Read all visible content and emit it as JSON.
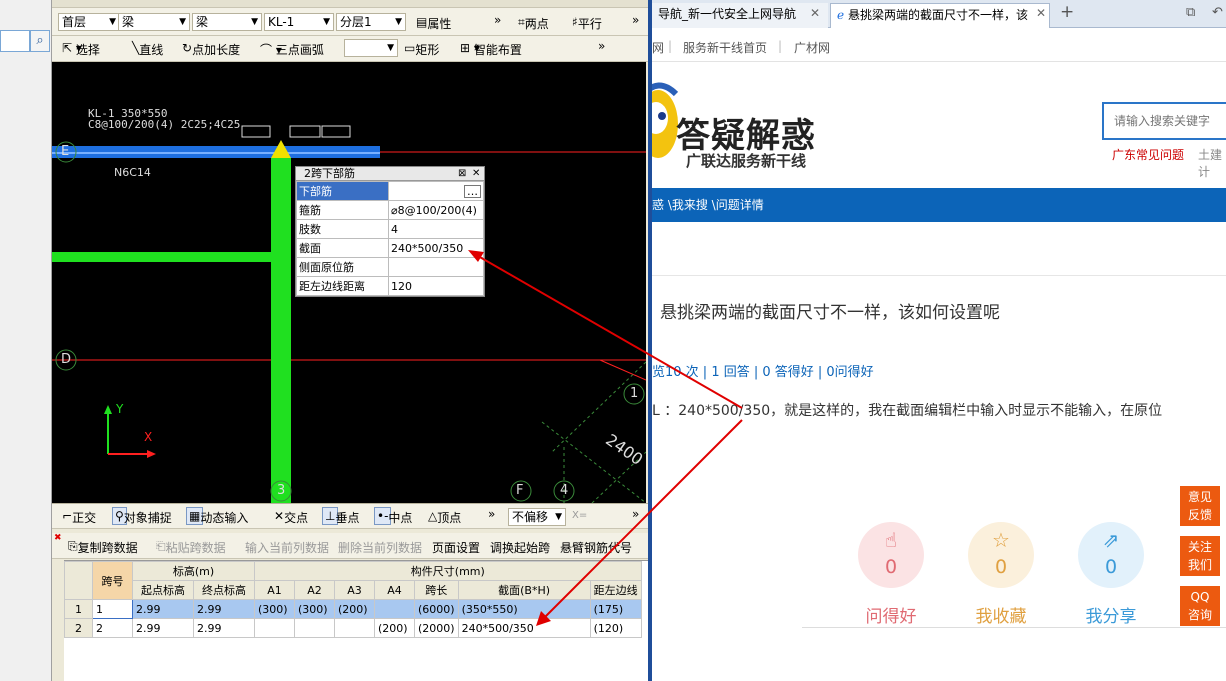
{
  "left_panel": {
    "search_icon": "search-icon"
  },
  "cad": {
    "toolbar1": {
      "floor": "首层",
      "type1": "梁",
      "type2": "梁",
      "component": "KL-1",
      "layer": "分层1",
      "properties": "属性",
      "more": "»",
      "two_points": "两点",
      "parallel": "平行"
    },
    "toolbar2": {
      "select": "选择",
      "line": "直线",
      "point_length": "点加长度",
      "arc": "三点画弧",
      "rect": "矩形",
      "smart": "智能布置",
      "more": "»"
    },
    "canvas": {
      "beam_label_1": "KL-1 350*550",
      "beam_label_2": "C8@100/200(4) 2C25;4C25",
      "rebar_label": "N6C14",
      "axis_e": "E",
      "axis_d": "D",
      "axis_3": "3",
      "axis_f": "F",
      "axis_4": "4",
      "axis_1": "1",
      "dim_2400": "2400",
      "ucs_y": "Y",
      "ucs_x": "X"
    },
    "popup": {
      "title": "2跨下部筋",
      "rows": [
        {
          "key": "下部筋",
          "value": ""
        },
        {
          "key": "箍筋",
          "value": "⌀8@100/200(4)"
        },
        {
          "key": "肢数",
          "value": "4"
        },
        {
          "key": "截面",
          "value": "240*500/350"
        },
        {
          "key": "侧面原位筋",
          "value": ""
        },
        {
          "key": "距左边线距离",
          "value": "120"
        }
      ],
      "ellipsis": "…"
    },
    "snapbar": {
      "ortho": "正交",
      "snap": "对象捕捉",
      "dynamic": "动态输入",
      "intersection": "交点",
      "perpendicular": "垂点",
      "midpoint": "中点",
      "vertex": "顶点",
      "more": "»",
      "offset": "不偏移",
      "x_label": "X="
    },
    "grid_toolbar": {
      "copy_span": "复制跨数据",
      "paste_span": "粘贴跨数据",
      "input_col": "输入当前列数据",
      "delete_col": "删除当前列数据",
      "page_setup": "页面设置",
      "adjust_start": "调换起始跨",
      "cantilever": "悬臂钢筋代号"
    },
    "grid": {
      "header_span_no": "跨号",
      "header_elev": "标高(m)",
      "header_dims": "构件尺寸(mm)",
      "subheaders": [
        "起点标高",
        "终点标高",
        "A1",
        "A2",
        "A3",
        "A4",
        "跨长",
        "截面(B*H)",
        "距左边线"
      ],
      "rows": [
        {
          "rn": "1",
          "span": "1",
          "start": "2.99",
          "end": "2.99",
          "a1": "(300)",
          "a2": "(300)",
          "a3": "(200)",
          "a4": "",
          "len": "(6000)",
          "section": "(350*550)",
          "left": "(175)"
        },
        {
          "rn": "2",
          "span": "2",
          "start": "2.99",
          "end": "2.99",
          "a1": "",
          "a2": "",
          "a3": "",
          "a4": "(200)",
          "len": "(2000)",
          "section": "240*500/350",
          "left": "(120)"
        }
      ]
    }
  },
  "browser": {
    "tabs": [
      {
        "label": "导航_新一代安全上网导航"
      },
      {
        "label": "悬挑梁两端的截面尺寸不一样，该"
      }
    ],
    "new_tab": "+",
    "links": {
      "l0": "网",
      "l1": "服务新干线首页",
      "l2": "广材网",
      "sep": "|"
    },
    "banner": {
      "title": "答疑解惑",
      "subtitle": "广联达服务新干线",
      "search_placeholder": "请输入搜索关键字",
      "hot1": "广东常见问题",
      "hot2": "土建计"
    },
    "breadcrumb": "惑 \\我来搜 \\问题详情",
    "question": {
      "title": "悬挑梁两端的截面尺寸不一样，该如何设置呢",
      "stats": "览10 次 | 1 回答 | 0 答得好 | 0问得好",
      "body": "L ：240*500/350，就是这样的，我在截面编辑栏中输入时显示不能输入，在原位"
    },
    "actions": [
      {
        "count": "0",
        "label": "问得好",
        "icon": "thumbs-up-icon",
        "color": "#e06a72",
        "bg": "#fbe3e4"
      },
      {
        "count": "0",
        "label": "我收藏",
        "icon": "star-icon",
        "color": "#e0a040",
        "bg": "#fbf0dc"
      },
      {
        "count": "0",
        "label": "我分享",
        "icon": "share-icon",
        "color": "#3b9ad8",
        "bg": "#e2f1fb"
      }
    ],
    "side_buttons": [
      "意见\n反馈",
      "关注\n我们",
      "QQ\n咨询"
    ]
  },
  "colors": {
    "annotation_arrow": "#e00000",
    "beam_blue": "#1e6fe0",
    "wall_green": "#20e020",
    "axis_red": "#ff2020"
  }
}
